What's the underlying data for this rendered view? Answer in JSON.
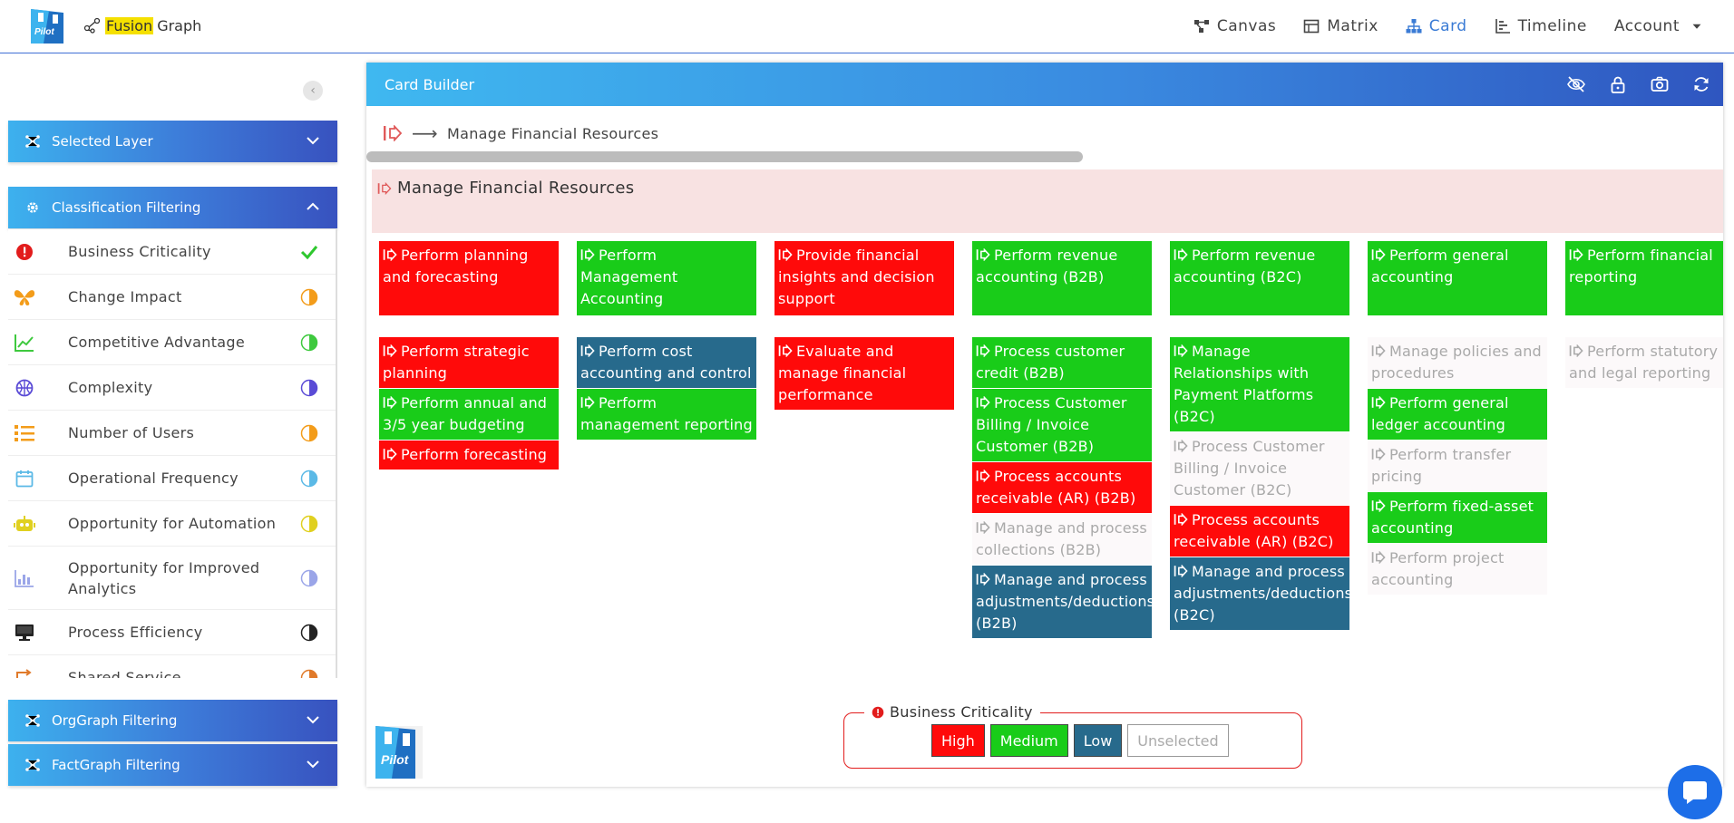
{
  "topbar": {
    "brand_prefix": "Fusion",
    "brand_suffix": "Graph",
    "logo_text": "Pilot",
    "nav": [
      {
        "label": "Canvas",
        "icon": "canvas-icon"
      },
      {
        "label": "Matrix",
        "icon": "matrix-icon"
      },
      {
        "label": "Card",
        "icon": "card-icon",
        "active": true
      },
      {
        "label": "Timeline",
        "icon": "timeline-icon"
      },
      {
        "label": "Account",
        "icon": "caret-down-icon"
      }
    ]
  },
  "sidebar": {
    "selected_layer": "Selected Layer",
    "classification": "Classification Filtering",
    "orggraph": "OrgGraph Filtering",
    "factgraph": "FactGraph Filtering",
    "items": [
      {
        "label": "Business Criticality",
        "color": "#e21c1c",
        "status": "check"
      },
      {
        "label": "Change Impact",
        "color": "#f39c1a",
        "status": "half"
      },
      {
        "label": "Competitive Advantage",
        "color": "#3ec93e",
        "status": "half"
      },
      {
        "label": "Complexity",
        "color": "#5a4bd6",
        "status": "half"
      },
      {
        "label": "Number of Users",
        "color": "#f39c1a",
        "status": "half"
      },
      {
        "label": "Operational Frequency",
        "color": "#5bb9e6",
        "status": "half"
      },
      {
        "label": "Opportunity for Automation",
        "color": "#e0d020",
        "status": "half"
      },
      {
        "label": "Opportunity for Improved Analytics",
        "color": "#9aa5e8",
        "status": "half"
      },
      {
        "label": "Process Efficiency",
        "color": "#222222",
        "status": "half"
      },
      {
        "label": "Shared Service",
        "color": "#e07a2a",
        "status": "half"
      }
    ]
  },
  "builder": {
    "title": "Card Builder",
    "breadcrumb": "Manage Financial Resources",
    "root": "Manage Financial Resources",
    "legend_title": "Business Criticality",
    "legend": {
      "high": "High",
      "medium": "Medium",
      "low": "Low",
      "unselected": "Unselected"
    },
    "columns": [
      {
        "l1": {
          "label": "Perform planning and forecasting",
          "level": "red"
        },
        "children": [
          {
            "label": "Perform strategic planning",
            "level": "red"
          },
          {
            "label": "Perform annual and 3/5 year budgeting",
            "level": "green"
          },
          {
            "label": "Perform forecasting",
            "level": "red"
          }
        ]
      },
      {
        "l1": {
          "label": "Perform Management Accounting",
          "level": "green"
        },
        "children": [
          {
            "label": "Perform cost accounting and control",
            "level": "blue"
          },
          {
            "label": "Perform management reporting",
            "level": "green"
          }
        ]
      },
      {
        "l1": {
          "label": "Provide financial insights and decision support",
          "level": "red"
        },
        "children": [
          {
            "label": "Evaluate and manage financial performance",
            "level": "red"
          }
        ]
      },
      {
        "l1": {
          "label": "Perform revenue accounting (B2B)",
          "level": "green"
        },
        "children": [
          {
            "label": "Process customer credit (B2B)",
            "level": "green"
          },
          {
            "label": "Process Customer Billing / Invoice Customer (B2B)",
            "level": "green"
          },
          {
            "label": "Process accounts receivable (AR) (B2B)",
            "level": "red"
          },
          {
            "label": "Manage and process collections (B2B)",
            "level": "gray"
          },
          {
            "label": "Manage and process adjustments/deductions (B2B)",
            "level": "blue"
          }
        ]
      },
      {
        "l1": {
          "label": "Perform revenue accounting (B2C)",
          "level": "green"
        },
        "children": [
          {
            "label": "Manage Relationships with Payment Platforms (B2C)",
            "level": "green"
          },
          {
            "label": "Process Customer Billing / Invoice Customer (B2C)",
            "level": "gray"
          },
          {
            "label": "Process accounts receivable (AR) (B2C)",
            "level": "red"
          },
          {
            "label": "Manage and process adjustments/deductions (B2C)",
            "level": "blue"
          }
        ]
      },
      {
        "l1": {
          "label": "Perform general accounting",
          "level": "green"
        },
        "children": [
          {
            "label": "Manage policies and procedures",
            "level": "gray"
          },
          {
            "label": "Perform general ledger accounting",
            "level": "green"
          },
          {
            "label": "Perform transfer pricing",
            "level": "gray"
          },
          {
            "label": "Perform fixed-asset accounting",
            "level": "green"
          },
          {
            "label": "Perform project accounting",
            "level": "gray"
          }
        ]
      },
      {
        "l1": {
          "label": "Perform financial reporting",
          "level": "green"
        },
        "children": [
          {
            "label": "Perform statutory and legal reporting",
            "level": "gray"
          }
        ]
      }
    ]
  }
}
